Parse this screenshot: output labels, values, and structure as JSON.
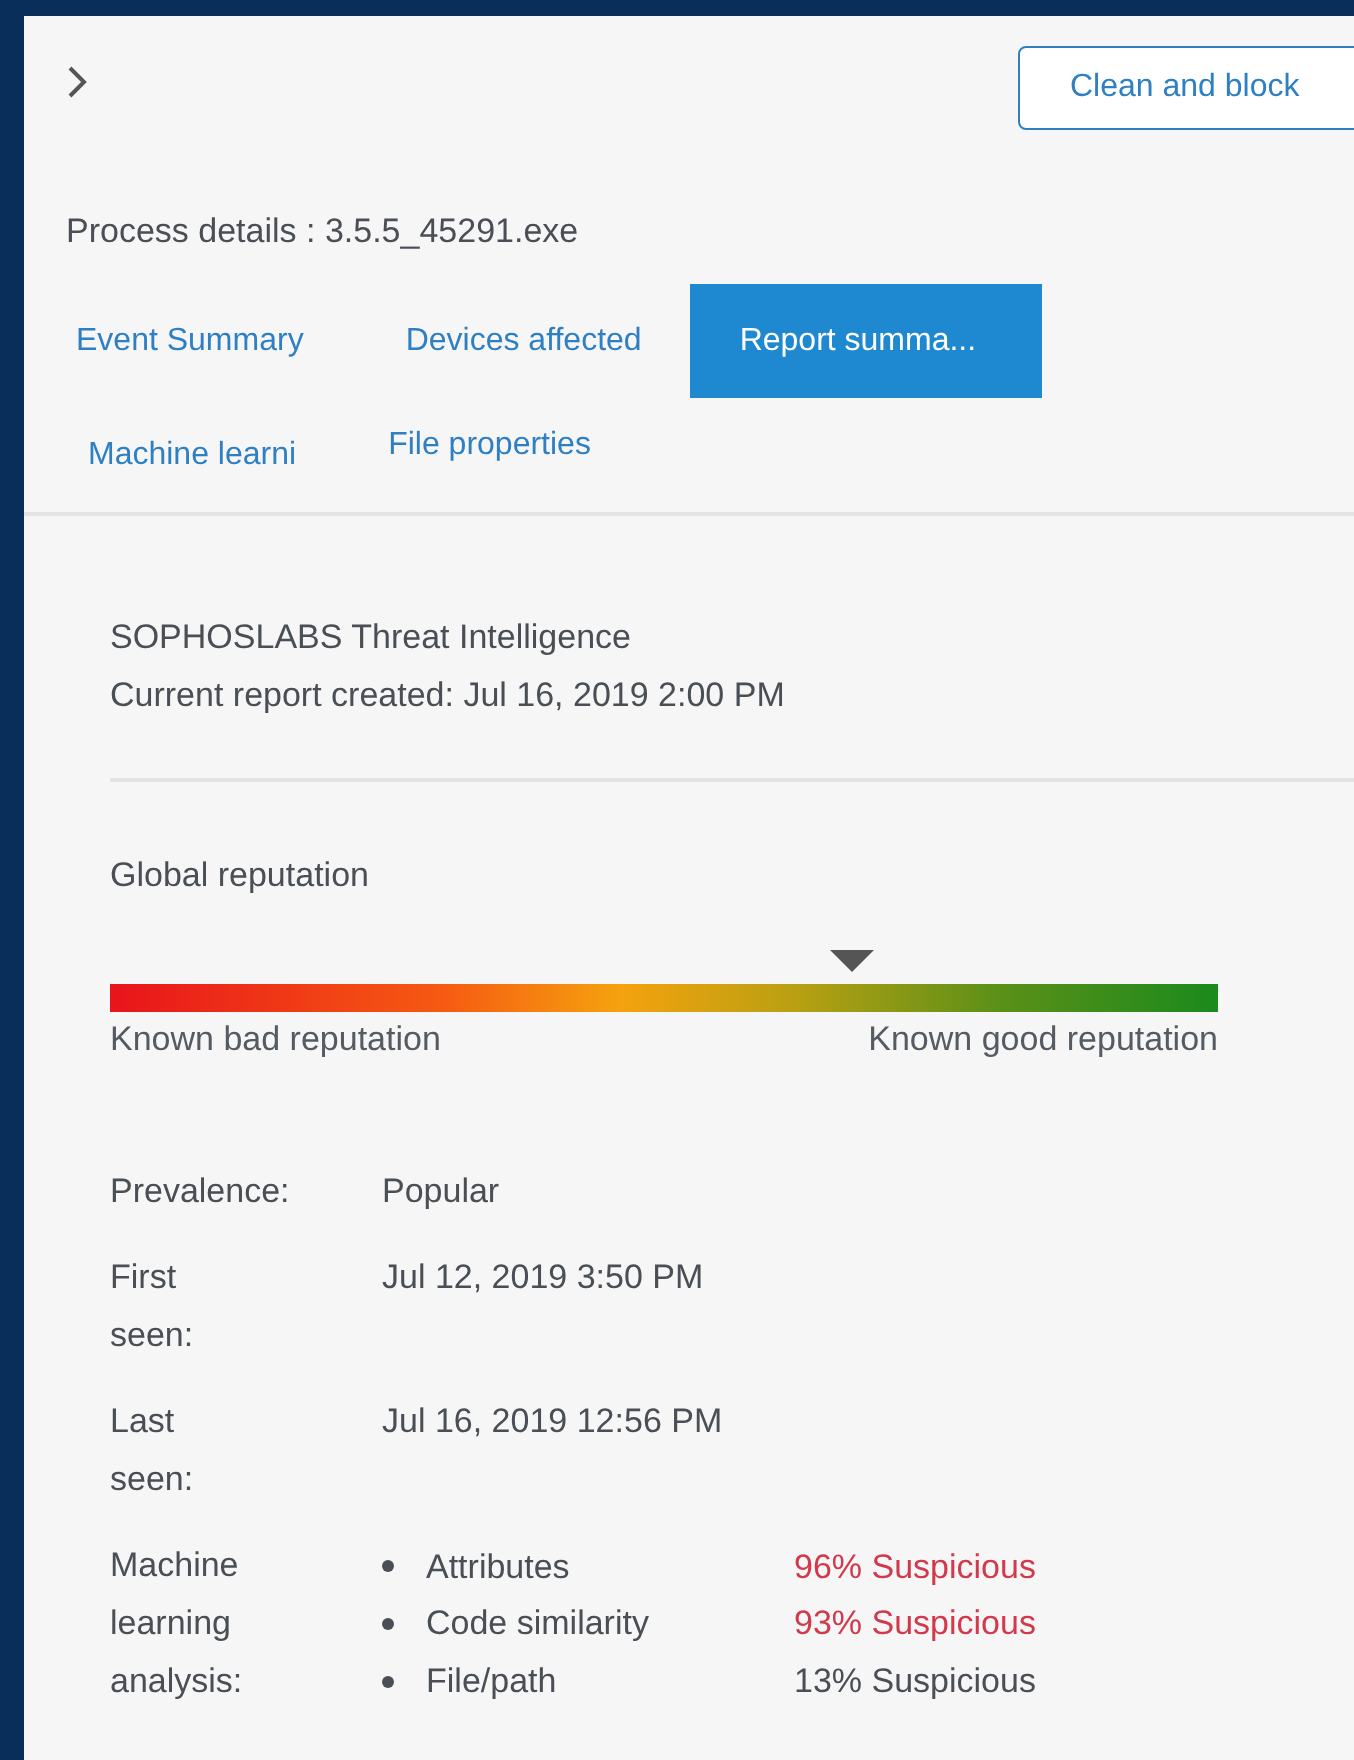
{
  "header": {
    "action_button": "Clean and block"
  },
  "process_details": "Process details : 3.5.5_45291.exe",
  "tabs": [
    {
      "label": "Event Summary",
      "selected": false
    },
    {
      "label": "Devices affected",
      "selected": false
    },
    {
      "label": "Report summa...",
      "selected": true
    },
    {
      "label": "Machine learni",
      "selected": false
    },
    {
      "label": "File properties",
      "selected": false
    }
  ],
  "report": {
    "title": "SOPHOSLABS Threat Intelligence",
    "created": "Current report created: Jul 16, 2019 2:00 PM"
  },
  "reputation": {
    "label": "Global reputation",
    "level": 0.67,
    "low_label": "Known bad reputation",
    "high_label": "Known good reputation"
  },
  "details": [
    {
      "label": "Prevalence:",
      "value": "Popular"
    },
    {
      "label": "First seen:",
      "value": "Jul 12, 2019 3:50 PM"
    },
    {
      "label": "Last seen:",
      "value": "Jul 16, 2019 12:56 PM"
    }
  ],
  "machine_learning": {
    "label": "Machine learning analysis:",
    "items": [
      {
        "name": "Attributes",
        "result": "96% Suspicious",
        "flagged": true
      },
      {
        "name": "Code similarity",
        "result": "93% Suspicious",
        "flagged": true
      },
      {
        "name": "File/path",
        "result": "13% Suspicious",
        "flagged": false
      }
    ]
  }
}
